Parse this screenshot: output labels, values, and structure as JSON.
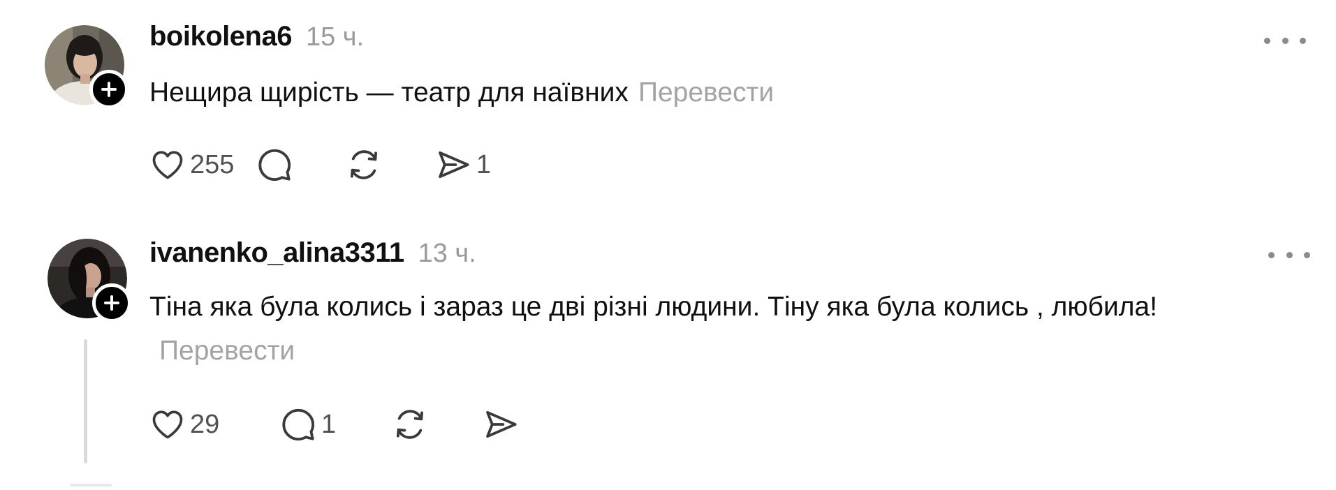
{
  "posts": [
    {
      "username": "boikolena6",
      "time": "15 ч.",
      "text": "Нещира щирість — театр для наївних",
      "translate": "Перевести",
      "likes": "255",
      "replies": "",
      "reposts": "",
      "shares": "1"
    },
    {
      "username": "ivanenko_alina3311",
      "time": "13 ч.",
      "text": "Тіна яка була колись і зараз це дві різні людини. Тіну яка була колись , любила!",
      "translate": "Перевести",
      "likes": "29",
      "replies": "1",
      "reposts": "",
      "shares": ""
    }
  ],
  "icons": {
    "like": "heart-icon",
    "reply": "comment-bubble-icon",
    "repost": "repost-icon",
    "share": "send-icon",
    "more": "more-horizontal-icon",
    "follow": "plus-icon"
  },
  "colors": {
    "text": "#101010",
    "muted": "#9a9a9a",
    "icon": "#3a3a3a",
    "thread_line": "#d9d9d9",
    "badge": "#000000"
  }
}
